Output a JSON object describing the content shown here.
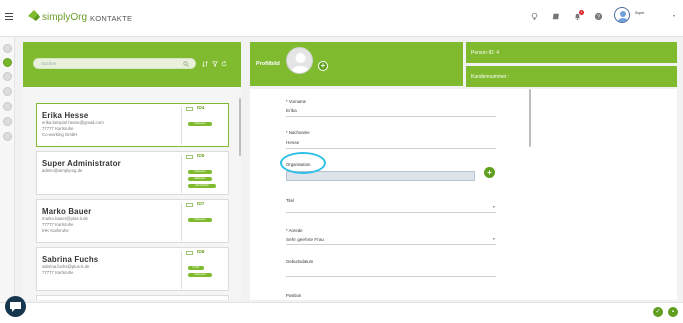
{
  "app": {
    "logo_text": "simplyOrg",
    "module_title": "KONTAKTE"
  },
  "user": {
    "name": "Super",
    "notifications": "1"
  },
  "search": {
    "placeholder": "Suchen"
  },
  "contacts": [
    {
      "name": "Erika Hesse",
      "email": "erika.beispiel.hesse@gmail.com",
      "city": "77777 Karlsruhe",
      "org": "Co-working GmbH",
      "id": "ID4",
      "badges": [
        "Interessent"
      ]
    },
    {
      "name": "Super Administrator",
      "email": "admin@simplyorg.de",
      "id": "ID5",
      "badges": [
        "Interessent",
        "Mitarbeiter",
        "Administrator"
      ]
    },
    {
      "name": "Marko Bauer",
      "email": "marko.bauer@plus-it.de",
      "city": "77777 Karlsruhe",
      "org": "IHK Karlsruhe",
      "id": "ID7",
      "badges": [
        "Interessent"
      ]
    },
    {
      "name": "Sabrina Fuchs",
      "email": "sabrina.fuchs@plus-it.de",
      "city": "77777 Karlsruhe",
      "id": "ID8",
      "badges": [
        "Kunde",
        "Interessent"
      ]
    }
  ],
  "profile": {
    "label": "Profilbild",
    "person_id": "Person-ID: 4",
    "customer_number": "Kundennummer :"
  },
  "form": {
    "vorname_label": "* Vorname",
    "vorname_value": "Erika",
    "nachname_label": "* Nachname",
    "nachname_value": "Hesse",
    "organisation_label": "Organisation",
    "titel_label": "Titel",
    "anrede_label": "* Anrede",
    "anrede_value": "Sehr geehrte Frau",
    "geburtsdatum_label": "Geburtsdatum",
    "position_label": "Position"
  },
  "colors": {
    "brand_green": "#7fba2f",
    "highlight_ring": "#2ec0e8"
  }
}
